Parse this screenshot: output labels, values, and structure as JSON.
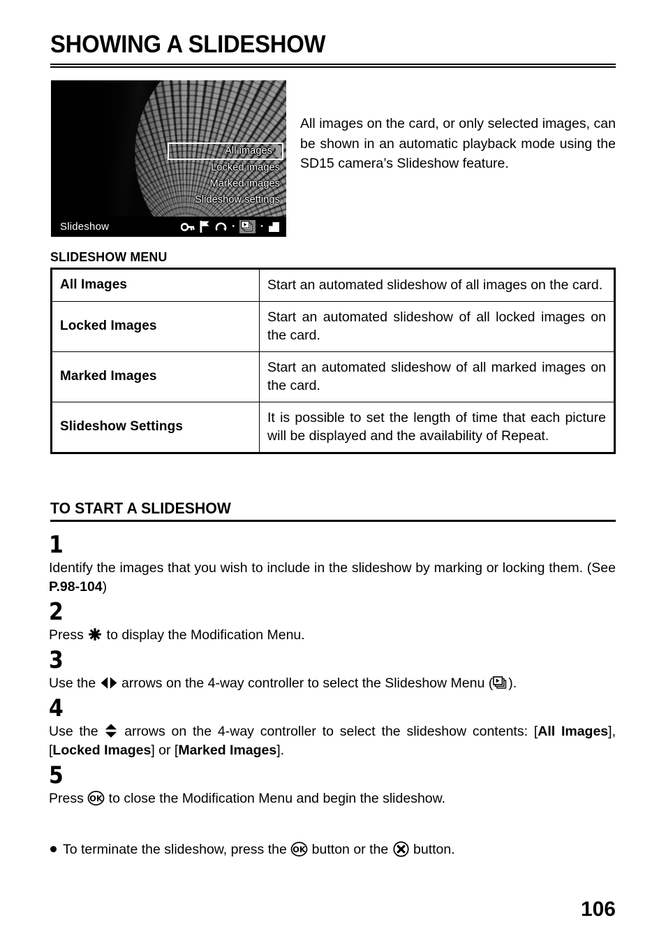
{
  "document": {
    "title": "SHOWING A SLIDESHOW",
    "page_number": "106"
  },
  "figure": {
    "name": "camera-lcd-slideshow-menu",
    "menu_items": [
      {
        "label": "All images",
        "selected": true
      },
      {
        "label": "Locked images",
        "selected": false
      },
      {
        "label": "Marked images",
        "selected": false
      },
      {
        "label": "Slideshow settings",
        "selected": false
      }
    ],
    "status_bar": {
      "label": "Slideshow",
      "icons": [
        {
          "name": "key-lock-icon",
          "active": false
        },
        {
          "name": "flag-mark-icon",
          "active": false
        },
        {
          "name": "rotate-icon",
          "active": false
        },
        {
          "name": "slideshow-icon",
          "active": true
        },
        {
          "name": "print-icon",
          "active": false
        }
      ]
    }
  },
  "intro": {
    "text": "All images on the card, or only selected images, can be shown in an automatic playback mode using the SD15 camera’s Slideshow feature."
  },
  "slideshow_menu": {
    "heading": "SLIDESHOW MENU",
    "rows": [
      {
        "label": "All Images",
        "description": "Start an automated slideshow of all images on the card."
      },
      {
        "label": "Locked Images",
        "description": "Start an automated slideshow of all locked images on the card."
      },
      {
        "label": "Marked Images",
        "description": "Start an automated slideshow of all marked images on the card."
      },
      {
        "label": "Slideshow Settings",
        "description": "It is possible to set the length of time that each picture will be displayed and the availability of Repeat."
      }
    ]
  },
  "procedure": {
    "heading": "TO START A SLIDESHOW",
    "steps": [
      {
        "number": "1",
        "text_a": "Identify the images that you wish to include in the slideshow by marking or locking them. (See ",
        "bold_b": "P.98-104",
        "text_c": ")"
      },
      {
        "number": "2",
        "text_a": "Press ",
        "icon": "asterisk-button-icon",
        "text_c": " to display the Modification Menu."
      },
      {
        "number": "3",
        "text_a": "Use the ",
        "icon": "left-right-arrows-icon",
        "text_c": " arrows on the 4-way controller to select the Slideshow Menu (",
        "icon_2": "slideshow-icon",
        "text_e": ")."
      },
      {
        "number": "4",
        "text_a": "Use the ",
        "icon": "up-down-arrows-icon",
        "text_c": " arrows on the 4-way controller to select the slideshow contents: [",
        "bold_b": "All Images",
        "text_d": "], [",
        "bold_c": "Locked Images",
        "text_e": "] or [",
        "bold_d": "Marked Images",
        "text_f": "]."
      },
      {
        "number": "5",
        "text_a": "Press ",
        "icon": "ok-button-icon",
        "text_c": " to close the Modification Menu and begin the slideshow."
      }
    ],
    "note": {
      "text_a": "To terminate the slideshow, press the ",
      "icon_1": "ok-button-icon",
      "text_b": " button or the ",
      "icon_2": "cancel-x-button-icon",
      "text_c": " button."
    }
  }
}
